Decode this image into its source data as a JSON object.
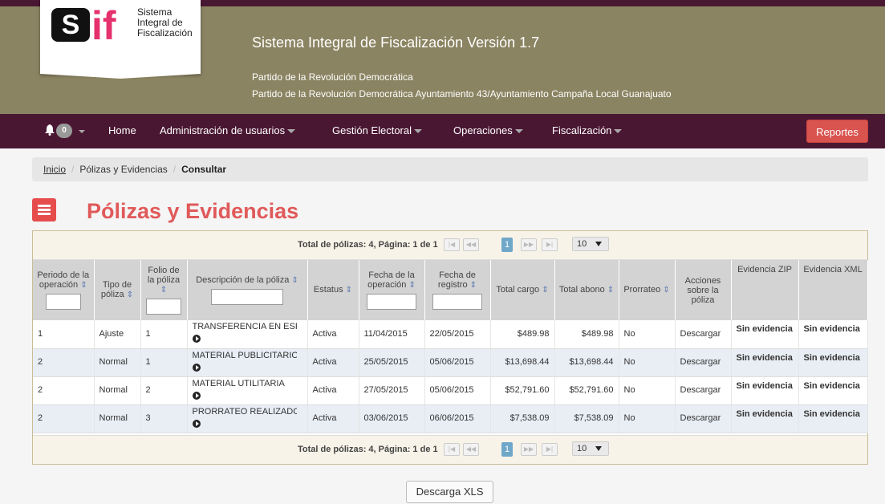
{
  "header": {
    "logo_lines": [
      "Sistema",
      "Integral de",
      "Fiscalización"
    ],
    "title": "Sistema Integral de Fiscalización Versión 1.7",
    "party_line1": "Partido de la Revolución Democrática",
    "party_line2": "Partido de la Revolución Democrática Ayuntamiento 43/Ayuntamiento Campaña Local Guanajuato"
  },
  "nav": {
    "badge": "0",
    "items": [
      "Home",
      "Administración de usuarios",
      "Gestión Electoral",
      "Operaciones",
      "Fiscalización"
    ],
    "reportes_label": "Reportes"
  },
  "breadcrumb": {
    "inicio": "Inicio",
    "section": "Pólizas y Evidencias",
    "current": "Consultar"
  },
  "page": {
    "title": "Pólizas y Evidencias"
  },
  "pager": {
    "info": "Total de pólizas: 4, Página: 1 de 1",
    "current_page": "1",
    "page_size": "10",
    "first": "|◀",
    "prev": "◀◀",
    "next": "▶▶",
    "last": "▶|"
  },
  "table": {
    "columns": [
      "Periodo de la operación",
      "Tipo de póliza",
      "Folio de la póliza",
      "Descripción de la póliza",
      "Estatus",
      "Fecha de la operación",
      "Fecha de registro",
      "Total cargo",
      "Total abono",
      "Prorrateo",
      "Acciones sobre la póliza",
      "Evidencia ZIP",
      "Evidencia XML"
    ],
    "rows": [
      {
        "periodo": "1",
        "tipo": "Ajuste",
        "folio": "1",
        "descripcion": "TRANSFERENCIA EN ESPECIE",
        "estatus": "Activa",
        "fecha_operacion": "11/04/2015",
        "fecha_registro": "22/05/2015",
        "cargo": "$489.98",
        "abono": "$489.98",
        "prorrateo": "No",
        "accion": "Descargar",
        "zip": "Sin evidencia",
        "xml": "Sin evidencia"
      },
      {
        "periodo": "2",
        "tipo": "Normal",
        "folio": "1",
        "descripcion": "MATERIAL PUBLICITARIO",
        "estatus": "Activa",
        "fecha_operacion": "25/05/2015",
        "fecha_registro": "05/06/2015",
        "cargo": "$13,698.44",
        "abono": "$13,698.44",
        "prorrateo": "No",
        "accion": "Descargar",
        "zip": "Sin evidencia",
        "xml": "Sin evidencia"
      },
      {
        "periodo": "2",
        "tipo": "Normal",
        "folio": "2",
        "descripcion": "MATERIAL UTILITARIA",
        "estatus": "Activa",
        "fecha_operacion": "27/05/2015",
        "fecha_registro": "05/06/2015",
        "cargo": "$52,791.60",
        "abono": "$52,791.60",
        "prorrateo": "No",
        "accion": "Descargar",
        "zip": "Sin evidencia",
        "xml": "Sin evidencia"
      },
      {
        "periodo": "2",
        "tipo": "Normal",
        "folio": "3",
        "descripcion": "PRORRATEO REALIZADO PO",
        "estatus": "Activa",
        "fecha_operacion": "03/06/2015",
        "fecha_registro": "06/06/2015",
        "cargo": "$7,538.09",
        "abono": "$7,538.09",
        "prorrateo": "No",
        "accion": "Descargar",
        "zip": "Sin evidencia",
        "xml": "Sin evidencia"
      }
    ]
  },
  "download_xls_label": "Descarga XLS",
  "colors": {
    "banner": "#8b8462",
    "navbar": "#4a1733",
    "accent_red": "#d9534f",
    "title_red": "#e05a5a",
    "logo_pink": "#e5316d"
  }
}
